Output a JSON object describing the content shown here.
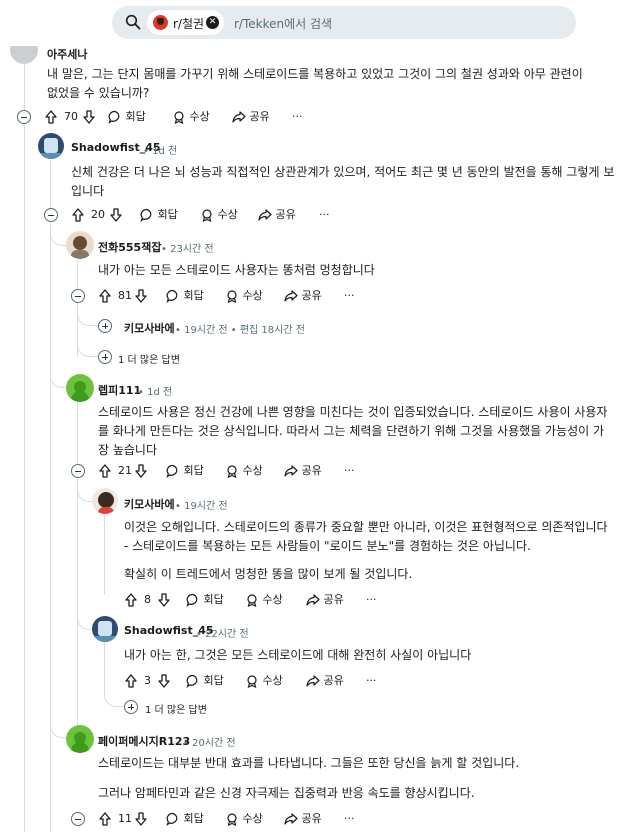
{
  "search": {
    "chip_label": "r/철권",
    "placeholder": "r/Tekken에서 검색"
  },
  "action_labels": {
    "reply": "회답",
    "award": "수상",
    "share": "공유",
    "more": "···"
  },
  "top_comment": {
    "username": "아주세나",
    "text": "내 말은, 그는 단지 몸매를 가꾸기 위해 스테로이드를 복용하고 있었고 그것이 그의 철권 성과와 아무 관련이 없었을 수 있습니까?",
    "votes": "70"
  },
  "c1": {
    "username": "Shadowfist_45",
    "time": "• 1d 전",
    "text": "신체 건강은 더 나은 뇌 성능과 직접적인 상관관계가 있으며, 적어도 최근 몇 년 동안의 발전을 통해 그렇게 보입니다",
    "votes": "20"
  },
  "c2": {
    "username": "전화555잭잡",
    "time": "• 23시간 전",
    "text": "내가 아는 모든 스테로이드 사용자는 똥처럼 멍청합니다",
    "votes": "81"
  },
  "c2_child": {
    "username": "키모사바에",
    "time": "• 19시간 전 • 편집 18시간 전"
  },
  "c2_more": "1 더 많은 답변",
  "c3": {
    "username": "렙피111",
    "time": "• 1d 전",
    "text": "스테로이드 사용은 정신 건강에 나쁜 영향을 미친다는 것이 입증되었습니다. 스테로이드 사용이 사용자를 화나게 만든다는 것은 상식입니다. 따라서 그는 체력을 단련하기 위해 그것을 사용했을 가능성이 가장 높습니다",
    "votes": "21"
  },
  "c4": {
    "username": "키모사바에",
    "time": "• 19시간 전",
    "text1": "이것은 오해입니다. 스테로이드의 종류가 중요할 뿐만 아니라, 이것은 표현형적으로 의존적입니다 - 스테로이드를 복용하는 모든 사람들이 \"로이드 분노\"를 경험하는 것은 아닙니다.",
    "text2": "확실히 이 트레드에서 멍청한 똥을 많이 보게 될 것입니다.",
    "votes": "8"
  },
  "c5": {
    "username": "Shadowfist_45",
    "time": "• 22시간 전",
    "text": "내가 아는 한, 그것은 모든 스테로이드에 대해 완전히 사실이 아닙니다",
    "votes": "3"
  },
  "c5_more": "1 더 많은 답변",
  "c6": {
    "username": "페이퍼메시지R123",
    "time": "• 20시간 전",
    "text1": "스테로이드는 대부분 반대 효과를 나타냅니다. 그들은 또한 당신을 늙게 할 것입니다.",
    "text2": "그러나 암페타민과 같은 신경 자극제는 집중력과 반응 속도를 향상시킵니다.",
    "votes": "11"
  }
}
